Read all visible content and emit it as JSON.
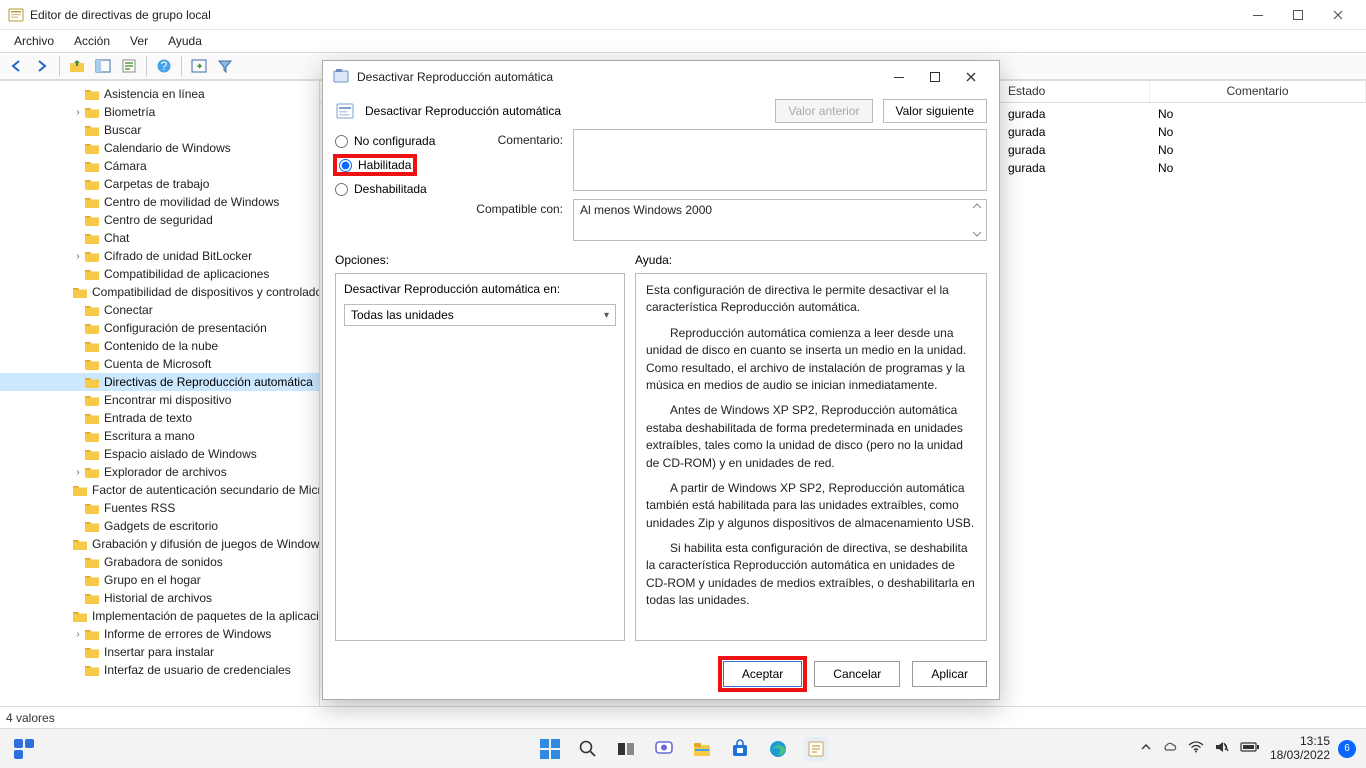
{
  "window": {
    "title": "Editor de directivas de grupo local",
    "menu": [
      "Archivo",
      "Acción",
      "Ver",
      "Ayuda"
    ],
    "statusbar": "4 valores"
  },
  "tree": {
    "items": [
      {
        "label": "Asistencia en línea",
        "depth": 4,
        "exp": ""
      },
      {
        "label": "Biometría",
        "depth": 4,
        "exp": ">"
      },
      {
        "label": "Buscar",
        "depth": 4,
        "exp": ""
      },
      {
        "label": "Calendario de Windows",
        "depth": 4,
        "exp": ""
      },
      {
        "label": "Cámara",
        "depth": 4,
        "exp": ""
      },
      {
        "label": "Carpetas de trabajo",
        "depth": 4,
        "exp": ""
      },
      {
        "label": "Centro de movilidad de Windows",
        "depth": 4,
        "exp": ""
      },
      {
        "label": "Centro de seguridad",
        "depth": 4,
        "exp": ""
      },
      {
        "label": "Chat",
        "depth": 4,
        "exp": ""
      },
      {
        "label": "Cifrado de unidad BitLocker",
        "depth": 4,
        "exp": ">"
      },
      {
        "label": "Compatibilidad de aplicaciones",
        "depth": 4,
        "exp": ""
      },
      {
        "label": "Compatibilidad de dispositivos y controladores",
        "depth": 4,
        "exp": ""
      },
      {
        "label": "Conectar",
        "depth": 4,
        "exp": ""
      },
      {
        "label": "Configuración de presentación",
        "depth": 4,
        "exp": ""
      },
      {
        "label": "Contenido de la nube",
        "depth": 4,
        "exp": ""
      },
      {
        "label": "Cuenta de Microsoft",
        "depth": 4,
        "exp": ""
      },
      {
        "label": "Directivas de Reproducción automática",
        "depth": 4,
        "exp": "",
        "selected": true
      },
      {
        "label": "Encontrar mi dispositivo",
        "depth": 4,
        "exp": ""
      },
      {
        "label": "Entrada de texto",
        "depth": 4,
        "exp": ""
      },
      {
        "label": "Escritura a mano",
        "depth": 4,
        "exp": ""
      },
      {
        "label": "Espacio aislado de Windows",
        "depth": 4,
        "exp": ""
      },
      {
        "label": "Explorador de archivos",
        "depth": 4,
        "exp": ">"
      },
      {
        "label": "Factor de autenticación secundario de Microsoft",
        "depth": 4,
        "exp": ""
      },
      {
        "label": "Fuentes RSS",
        "depth": 4,
        "exp": ""
      },
      {
        "label": "Gadgets de escritorio",
        "depth": 4,
        "exp": ""
      },
      {
        "label": "Grabación y difusión de juegos de Windows",
        "depth": 4,
        "exp": ""
      },
      {
        "label": "Grabadora de sonidos",
        "depth": 4,
        "exp": ""
      },
      {
        "label": "Grupo en el hogar",
        "depth": 4,
        "exp": ""
      },
      {
        "label": "Historial de archivos",
        "depth": 4,
        "exp": ""
      },
      {
        "label": "Implementación de paquetes de la aplicación",
        "depth": 4,
        "exp": ""
      },
      {
        "label": "Informe de errores de Windows",
        "depth": 4,
        "exp": ">"
      },
      {
        "label": "Insertar para instalar",
        "depth": 4,
        "exp": ""
      },
      {
        "label": "Interfaz de usuario de credenciales",
        "depth": 4,
        "exp": ""
      }
    ]
  },
  "list": {
    "header": {
      "col_estado": "Estado",
      "col_com": "Comentario"
    },
    "rows": [
      {
        "estado": "gurada",
        "com": "No"
      },
      {
        "estado": "gurada",
        "com": "No"
      },
      {
        "estado": "gurada",
        "com": "No"
      },
      {
        "estado": "gurada",
        "com": "No"
      }
    ]
  },
  "dialog": {
    "title": "Desactivar Reproducción automática",
    "subtitle": "Desactivar Reproducción automática",
    "prev": "Valor anterior",
    "next": "Valor siguiente",
    "radios": {
      "not_conf": "No configurada",
      "enabled": "Habilitada",
      "disabled": "Deshabilitada"
    },
    "labels": {
      "comentario": "Comentario:",
      "compatible": "Compatible con:",
      "opciones": "Opciones:",
      "ayuda": "Ayuda:"
    },
    "compatible_text": "Al menos Windows 2000",
    "options": {
      "field_label": "Desactivar Reproducción automática en:",
      "field_value": "Todas las unidades"
    },
    "help": [
      "Esta configuración de directiva le permite desactivar el la característica Reproducción automática.",
      "Reproducción automática comienza a leer desde una unidad de disco en cuanto se inserta un medio en la unidad. Como resultado, el archivo de instalación de programas y la música en medios de audio se inician inmediatamente.",
      "Antes de Windows XP SP2, Reproducción automática estaba deshabilitada de forma predeterminada en unidades extraíbles, tales como la unidad de disco (pero no la unidad de CD-ROM) y en unidades de red.",
      "A partir de Windows XP SP2, Reproducción automática también está habilitada para las unidades extraíbles, como unidades Zip y algunos dispositivos de almacenamiento USB.",
      "Si habilita esta configuración de directiva, se deshabilita la característica Reproducción automática en unidades de CD-ROM y unidades de medios extraíbles, o deshabilitarla en todas las unidades."
    ],
    "buttons": {
      "accept": "Aceptar",
      "cancel": "Cancelar",
      "apply": "Aplicar"
    }
  },
  "taskbar": {
    "time": "13:15",
    "date": "18/03/2022",
    "notif_count": "6"
  }
}
